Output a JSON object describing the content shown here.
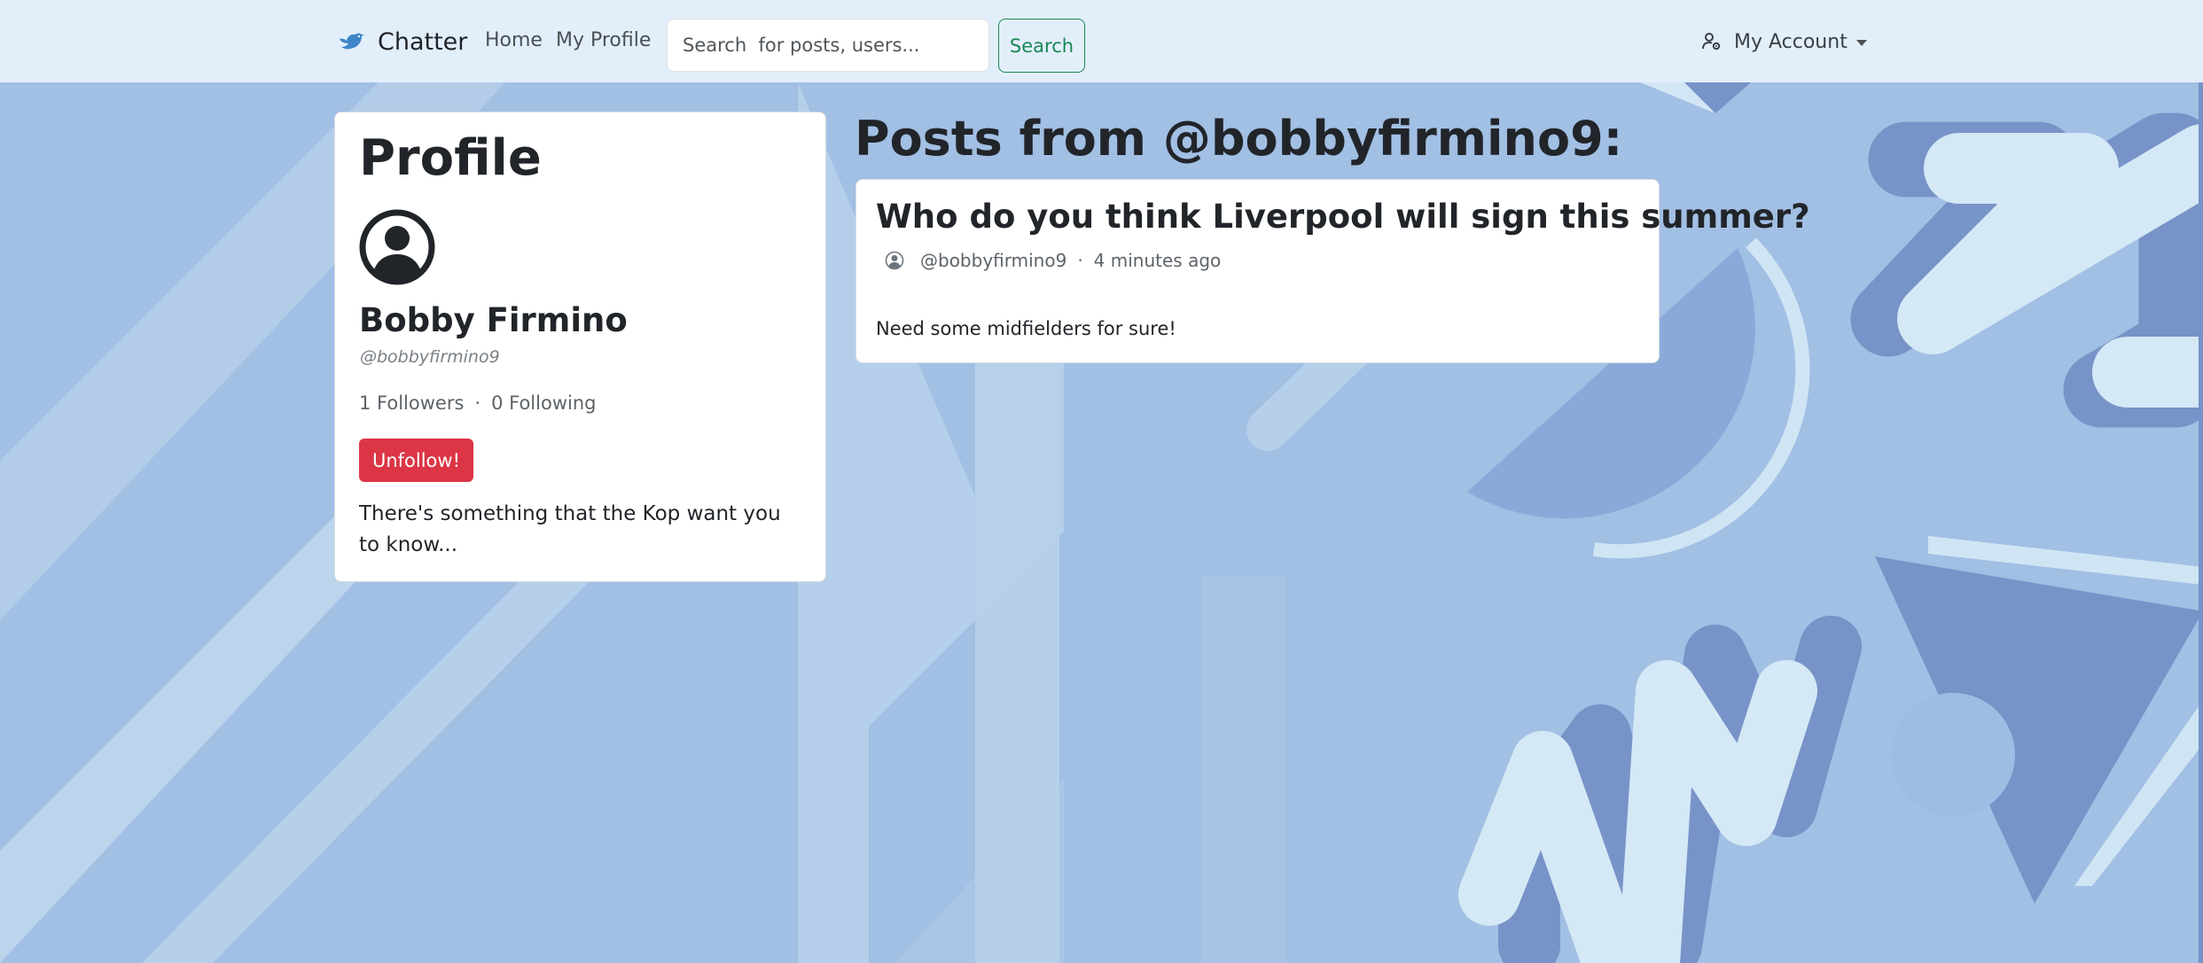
{
  "navbar": {
    "brand": "Chatter",
    "links": [
      "Home",
      "My Profile"
    ],
    "search_placeholder": "Search  for posts, users...",
    "search_button": "Search",
    "account_label": "My Account"
  },
  "profile": {
    "heading": "Profile",
    "name": "Bobby Firmino",
    "handle": "@bobbyfirmino9",
    "followers": "1 Followers",
    "separator": "·",
    "following": "0 Following",
    "unfollow_button": "Unfollow!",
    "bio": "There's something that the Kop want you to know..."
  },
  "posts": {
    "heading": "Posts from @bobbyfirmino9:",
    "items": [
      {
        "title": "Who do you think Liverpool will sign this summer?",
        "author": "@bobbyfirmino9",
        "separator": "·",
        "time": "4 minutes ago",
        "body": "Need some midfielders for sure!"
      }
    ]
  },
  "colors": {
    "navbar_bg": "#e2effb",
    "page_bg": "#a2bfe4",
    "search_button": "#198754",
    "unfollow_button": "#dc3545",
    "brand_bird": "#3e86c9"
  },
  "icons": {
    "brand": "bird-icon",
    "account": "person-gear-icon",
    "profile_avatar": "person-circle-icon",
    "post_avatar": "person-circle-icon",
    "account_caret": "caret-down-icon"
  }
}
